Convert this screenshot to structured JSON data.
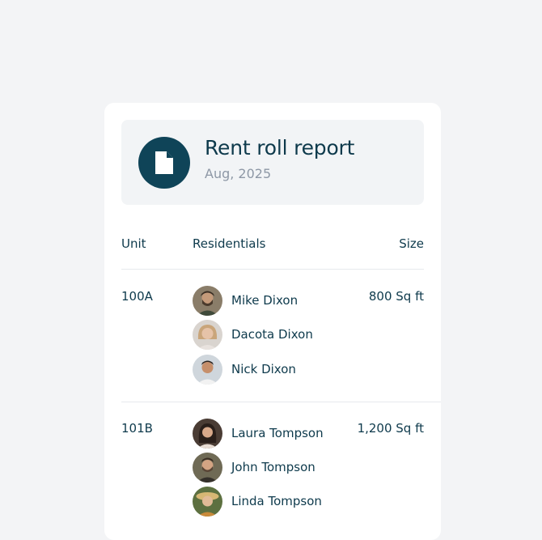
{
  "report": {
    "title": "Rent roll report",
    "period": "Aug, 2025",
    "icon": "document-icon"
  },
  "table": {
    "headers": {
      "unit": "Unit",
      "residentials": "Residentials",
      "size": "Size"
    },
    "rows": [
      {
        "unit": "100A",
        "size": "800 Sq ft",
        "residents": [
          {
            "name": "Mike Dixon"
          },
          {
            "name": "Dacota Dixon"
          },
          {
            "name": "Nick Dixon"
          }
        ]
      },
      {
        "unit": "101B",
        "size": "1,200 Sq ft",
        "residents": [
          {
            "name": "Laura Tompson"
          },
          {
            "name": "John Tompson"
          },
          {
            "name": "Linda Tompson"
          }
        ]
      }
    ]
  },
  "colors": {
    "primary": "#0f4458",
    "text": "#0e3a4c",
    "muted": "#8e98a6",
    "background": "#f3f4f6"
  }
}
